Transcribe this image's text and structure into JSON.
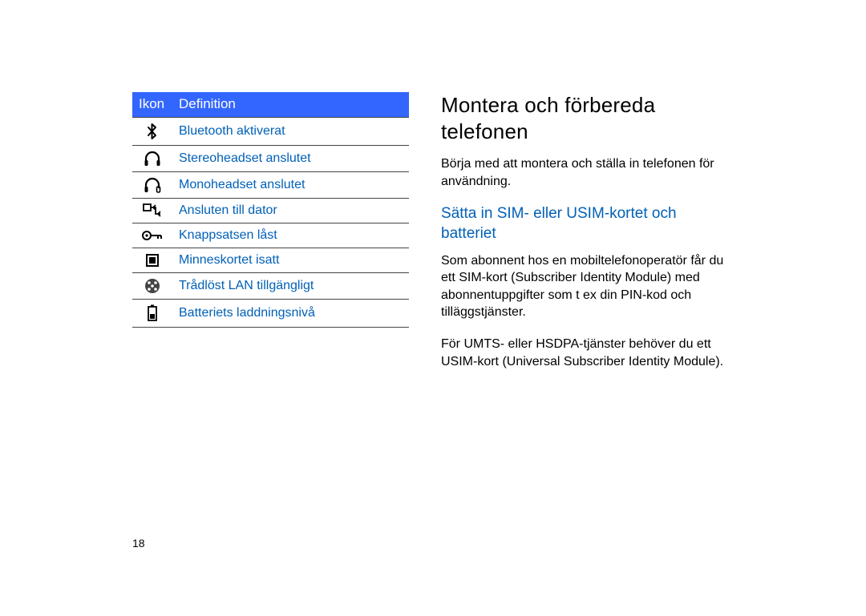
{
  "pageNumber": "18",
  "table": {
    "headers": {
      "icon": "Ikon",
      "definition": "Definition"
    },
    "rows": [
      {
        "icon_name": "bluetooth-icon",
        "definition": "Bluetooth aktiverat"
      },
      {
        "icon_name": "headphones-stereo-icon",
        "definition": "Stereoheadset anslutet"
      },
      {
        "icon_name": "headphones-mono-icon",
        "definition": "Monoheadset anslutet"
      },
      {
        "icon_name": "pc-connection-icon",
        "definition": "Ansluten till dator"
      },
      {
        "icon_name": "key-lock-icon",
        "definition": "Knappsatsen låst"
      },
      {
        "icon_name": "memory-card-icon",
        "definition": "Minneskortet isatt"
      },
      {
        "icon_name": "wlan-icon",
        "definition": "Trådlöst LAN tillgängligt"
      },
      {
        "icon_name": "battery-icon",
        "definition": "Batteriets laddningsnivå"
      }
    ]
  },
  "right": {
    "heading": "Montera och förbereda telefonen",
    "intro": "Börja med att montera och ställa in telefonen för användning.",
    "subheading": "Sätta in SIM- eller USIM-kortet och batteriet",
    "para1": "Som abonnent hos en mobiltelefonoperatör får du ett SIM-kort (Subscriber Identity Module) med abonnentuppgifter som t ex din PIN-kod och tilläggstjänster.",
    "para2": "För UMTS- eller HSDPA-tjänster behöver du ett USIM-kort (Universal Subscriber Identity Module)."
  }
}
